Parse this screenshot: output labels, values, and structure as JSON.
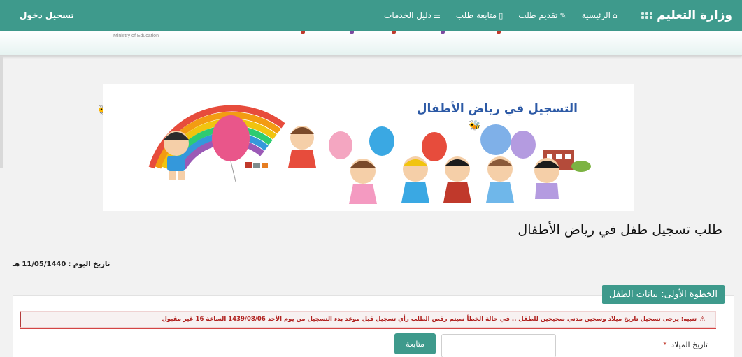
{
  "header": {
    "brand": "وزارة التعليم",
    "nav": [
      {
        "label": "الرئيسية",
        "icon": "home-icon",
        "glyph": "⌂"
      },
      {
        "label": "تقديم طلب",
        "icon": "edit-icon",
        "glyph": "✎"
      },
      {
        "label": "متابعة طلب",
        "icon": "document-icon",
        "glyph": "▯"
      },
      {
        "label": "دليل الخدمات",
        "icon": "list-icon",
        "glyph": "☰"
      }
    ],
    "login": "تسجيل دخول"
  },
  "subheader": {
    "ministry_en": "Ministry of Education"
  },
  "banner": {
    "title": "التسجيل في رياض الأطفال"
  },
  "page": {
    "title": "طلب تسجيل طفل في رياض الأطفال",
    "today_label": "تاريخ اليوم :",
    "today_value": "11/05/1440",
    "today_suffix": "هـ"
  },
  "form": {
    "step_title": "الخطوة الأولى: بيانات الطفل",
    "alert_text": "تنبيه: يرجى تسجيل تاريخ ميلاد وسجين مدني صحيحين للطفل .. في حالة الخطأ سيتم رفض الطلب رأي تسجيل قبل موعد بدء التسجيل من يوم الأحد 1439/08/06 الساعة 16 غير مقبول",
    "birth_date_label": "تاريخ الميلاد",
    "required_mark": "*",
    "birth_date_value": "",
    "continue_label": "متابعة"
  },
  "colors": {
    "primary": "#3e9a8c",
    "alert_text": "#b0211f",
    "banner_title": "#2d5aa6"
  }
}
